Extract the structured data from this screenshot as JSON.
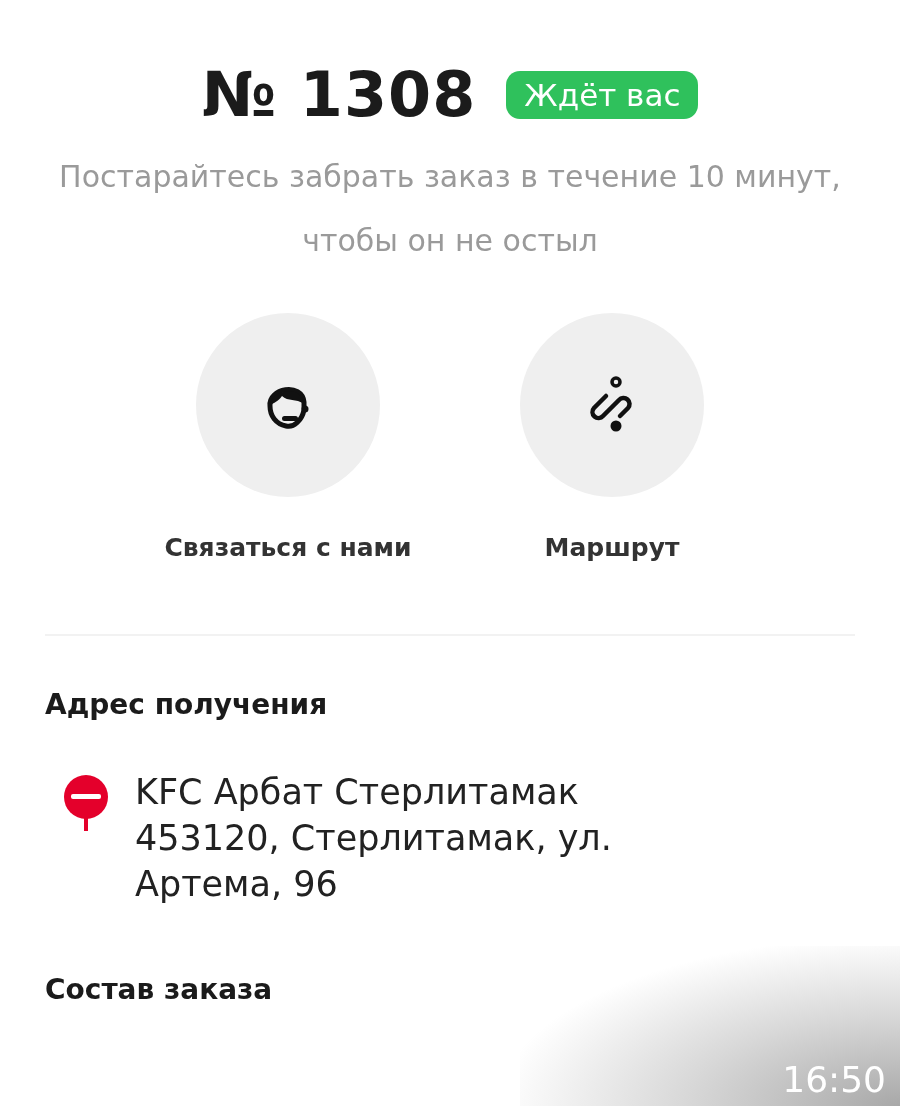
{
  "order": {
    "number": "№ 1308",
    "status": {
      "label": "Ждёт вас",
      "color": "#2fc15c"
    }
  },
  "message": "Постарайтесь забрать заказ в течение 10 минут, чтобы он не остыл",
  "actions": [
    {
      "kind": "support",
      "label": "Связаться с нами"
    },
    {
      "kind": "route",
      "label": "Маршрут"
    }
  ],
  "pickup": {
    "heading": "Адрес получения",
    "lines": [
      "KFC Арбат Стерлитамак",
      "453120, Стерлитамак, ул.",
      "Артема, 96"
    ]
  },
  "contents": {
    "heading": "Состав заказа"
  },
  "overlay": {
    "time": "16:50"
  }
}
